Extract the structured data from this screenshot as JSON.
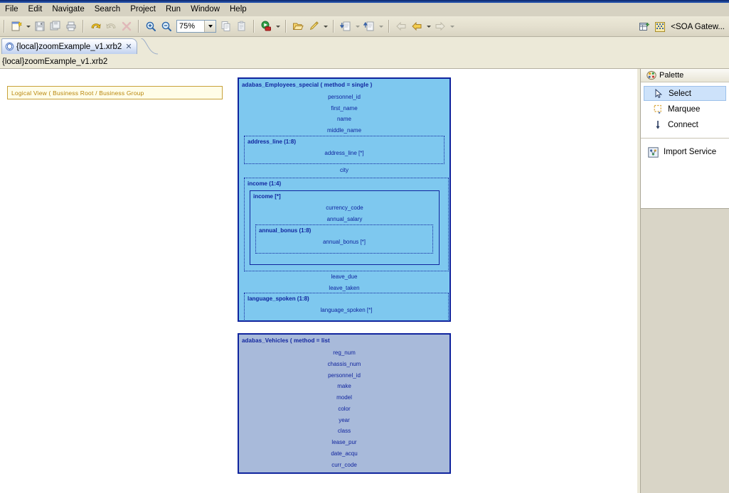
{
  "window": {
    "perspective_label": "<SOA Gatew..."
  },
  "menubar": {
    "items": [
      {
        "label": "File"
      },
      {
        "label": "Edit"
      },
      {
        "label": "Navigate"
      },
      {
        "label": "Search"
      },
      {
        "label": "Project"
      },
      {
        "label": "Run"
      },
      {
        "label": "Window"
      },
      {
        "label": "Help"
      }
    ]
  },
  "toolbar": {
    "zoom_value": "75%",
    "buttons": [
      {
        "name": "new-wizard-icon",
        "title": "New"
      },
      {
        "name": "save-icon",
        "title": "Save"
      },
      {
        "name": "save-all-icon",
        "title": "Save All"
      },
      {
        "name": "print-icon",
        "title": "Print"
      },
      {
        "name": "undo-icon",
        "title": "Undo"
      },
      {
        "name": "redo-icon",
        "title": "Redo"
      },
      {
        "name": "delete-icon",
        "title": "Delete"
      },
      {
        "name": "zoom-in-icon",
        "title": "Zoom In"
      },
      {
        "name": "zoom-out-icon",
        "title": "Zoom Out"
      },
      {
        "name": "copy-icon",
        "title": "Copy"
      },
      {
        "name": "paste-icon",
        "title": "Paste"
      },
      {
        "name": "run-icon",
        "title": "Run"
      },
      {
        "name": "open-resource-icon",
        "title": "Open Resource"
      },
      {
        "name": "annotate-icon",
        "title": "Annotate"
      },
      {
        "name": "import-icon",
        "title": "Import"
      },
      {
        "name": "export-icon",
        "title": "Export"
      },
      {
        "name": "back-icon",
        "title": "Back"
      },
      {
        "name": "previous-icon",
        "title": "Previous"
      },
      {
        "name": "forward-icon",
        "title": "Forward"
      }
    ]
  },
  "editor": {
    "tab_label": "{local}zoomExample_v1.xrb2",
    "tab_close": "✕",
    "path_label": "{local}zoomExample_v1.xrb2"
  },
  "canvas": {
    "logical_view_note": "Logical View   ( Business Root / Business Group"
  },
  "diagram": {
    "nodes": [
      {
        "id": "employees",
        "title": "adabas_Employees_special   ( method = single )",
        "fields_top": [
          "personnel_id",
          "first_name",
          "name",
          "middle_name"
        ],
        "group_address": {
          "label": "address_line (1:8)",
          "field": "address_line [*]"
        },
        "field_city": "city",
        "group_income": {
          "label": "income (1:4)",
          "inner": {
            "label": "income [*]",
            "fields": [
              "currency_code",
              "annual_salary"
            ],
            "group_bonus": {
              "label": "annual_bonus (1:8)",
              "field": "annual_bonus  [*]"
            }
          }
        },
        "fields_leave": [
          "leave_due",
          "leave_taken"
        ],
        "group_language": {
          "label": "language_spoken (1:8)",
          "field": "language_spoken [*]"
        }
      },
      {
        "id": "vehicles",
        "title": "adabas_Vehicles   ( method = list",
        "fields": [
          "reg_num",
          "chassis_num",
          "personnel_id",
          "make",
          "model",
          "color",
          "year",
          "class",
          "lease_pur",
          "date_acqu",
          "curr_code"
        ]
      }
    ]
  },
  "palette": {
    "title": "Palette",
    "tools": [
      {
        "label": "Select",
        "icon": "cursor-arrow-icon",
        "selected": true
      },
      {
        "label": "Marquee",
        "icon": "marquee-icon",
        "selected": false
      },
      {
        "label": "Connect",
        "icon": "connect-arrow-icon",
        "selected": false
      }
    ],
    "services": [
      {
        "label": "Import Service",
        "icon": "import-service-icon"
      }
    ]
  },
  "colors": {
    "node_employees_fill": "#7ec8ef",
    "node_vehicles_fill": "#a8bada",
    "node_border": "#10249e",
    "node_text": "#10249e",
    "note_fill": "#fffde8",
    "note_border": "#c8a23a",
    "note_text": "#b8860b",
    "canvas_rail": "#8e9ada",
    "chrome_bg": "#ece9d8",
    "selection": "#cde2fa"
  }
}
